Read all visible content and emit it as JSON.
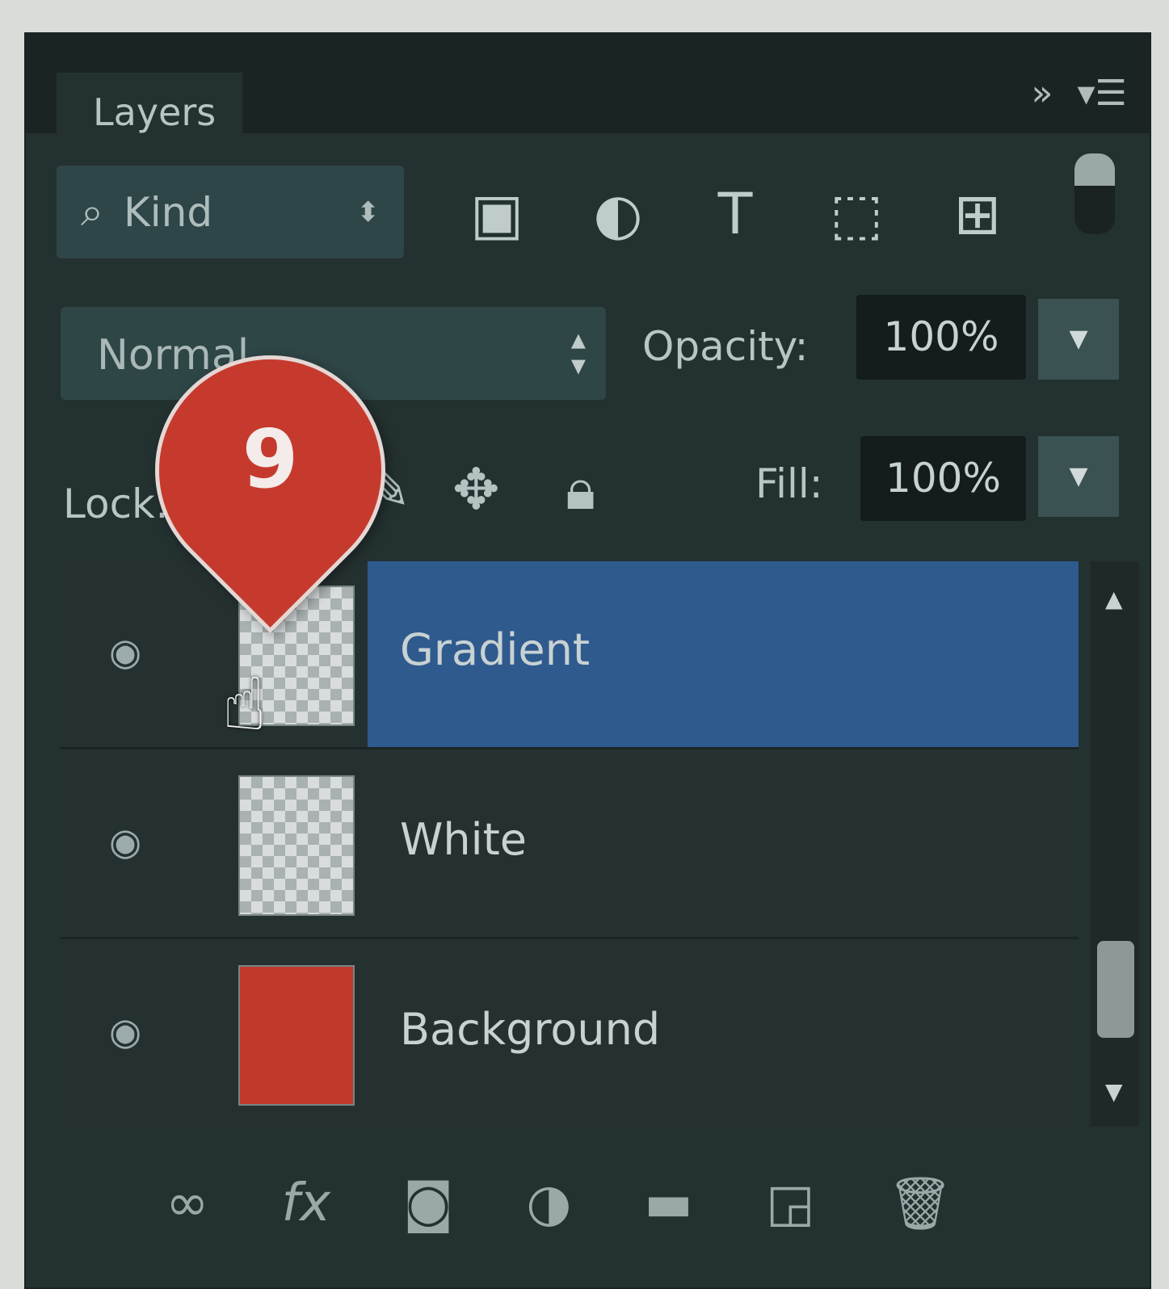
{
  "panel": {
    "tab_label": "Layers",
    "tab_controls": [
      "»",
      "▾☰"
    ]
  },
  "filter": {
    "kind_label": "Kind",
    "kind_icon": "search-icon",
    "icons": [
      "image-filter-icon",
      "adjustment-filter-icon",
      "type-filter-icon",
      "shape-filter-icon",
      "smart-object-filter-icon"
    ]
  },
  "blend": {
    "mode": "Normal",
    "opacity_label": "Opacity:",
    "opacity_value": "100%"
  },
  "lock": {
    "label": "Lock:",
    "fill_label": "Fill:",
    "fill_value": "100%"
  },
  "layers": [
    {
      "name": "Gradient",
      "selected": true,
      "thumb": "transparent"
    },
    {
      "name": "White",
      "selected": false,
      "thumb": "transparent"
    },
    {
      "name": "Background",
      "selected": false,
      "thumb": "#c0392b"
    }
  ],
  "footer_icons": [
    "link-icon",
    "fx-icon",
    "mask-icon",
    "adjustment-icon",
    "folder-icon",
    "new-layer-icon",
    "trash-icon"
  ],
  "callout": {
    "number": "9",
    "color": "#c63a2e"
  },
  "colors": {
    "panel": "#243131",
    "selection": "#2f5a8e"
  }
}
